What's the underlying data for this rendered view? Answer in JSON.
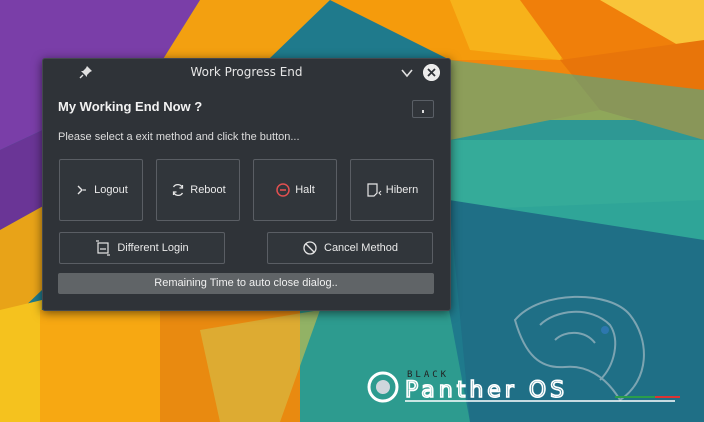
{
  "window": {
    "title": "Work Progress End"
  },
  "dialog": {
    "heading": "My Working End Now ?",
    "instruction": "Please select a exit method and click the button...",
    "buttons": [
      {
        "label": "Logout",
        "icon": "logout-icon"
      },
      {
        "label": "Reboot",
        "icon": "reboot-icon"
      },
      {
        "label": "Halt",
        "icon": "halt-icon"
      },
      {
        "label": "Hibern",
        "icon": "hibernate-icon"
      }
    ],
    "different_login": {
      "label": "Different Login",
      "icon": "switch-user-icon"
    },
    "cancel": {
      "label": "Cancel Method",
      "icon": "cancel-icon"
    },
    "progress": {
      "text": "Remaining Time to auto close dialog..",
      "value": 0.0
    }
  },
  "watermark": {
    "brand": "Panther OS",
    "tagline": "BLACK"
  },
  "colors": {
    "halt_accent": "#e05050",
    "dialog_bg": "#2f3338",
    "button_border": "#5a5e64"
  }
}
